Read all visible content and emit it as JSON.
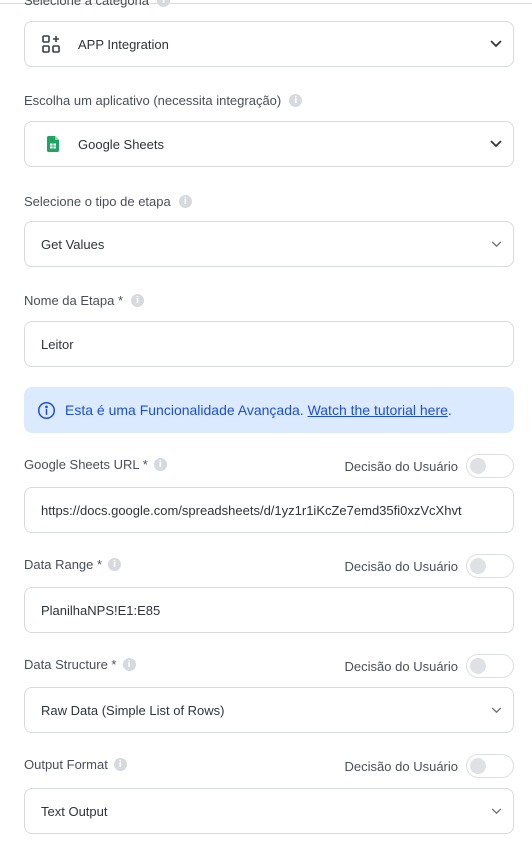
{
  "category": {
    "label": "Selecione a categoria",
    "value": "APP Integration",
    "icon": "apps-add-icon"
  },
  "app": {
    "label": "Escolha um aplicativo (necessita integração)",
    "value": "Google Sheets",
    "icon": "google-sheets-icon"
  },
  "step_type": {
    "label": "Selecione o tipo de etapa",
    "value": "Get Values"
  },
  "step_name": {
    "label": "Nome da Etapa *",
    "value": "Leitor"
  },
  "banner": {
    "text": "Esta é uma Funcionalidade Avançada.",
    "link": "Watch the tutorial here",
    "suffix": ".",
    "color": "#1d4ed8",
    "background": "#dbeafe"
  },
  "sheets_url": {
    "label": "Google Sheets URL *",
    "decision_label": "Decisão do Usuário",
    "value": "https://docs.google.com/spreadsheets/d/1yz1r1iKcZe7emd35fi0xzVcXhvt"
  },
  "data_range": {
    "label": "Data Range *",
    "decision_label": "Decisão do Usuário",
    "value": "PlanilhaNPS!E1:E85"
  },
  "data_structure": {
    "label": "Data Structure *",
    "decision_label": "Decisão do Usuário",
    "value": "Raw Data (Simple List of Rows)"
  },
  "output_format": {
    "label": "Output Format",
    "decision_label": "Decisão do Usuário",
    "value": "Text Output"
  }
}
